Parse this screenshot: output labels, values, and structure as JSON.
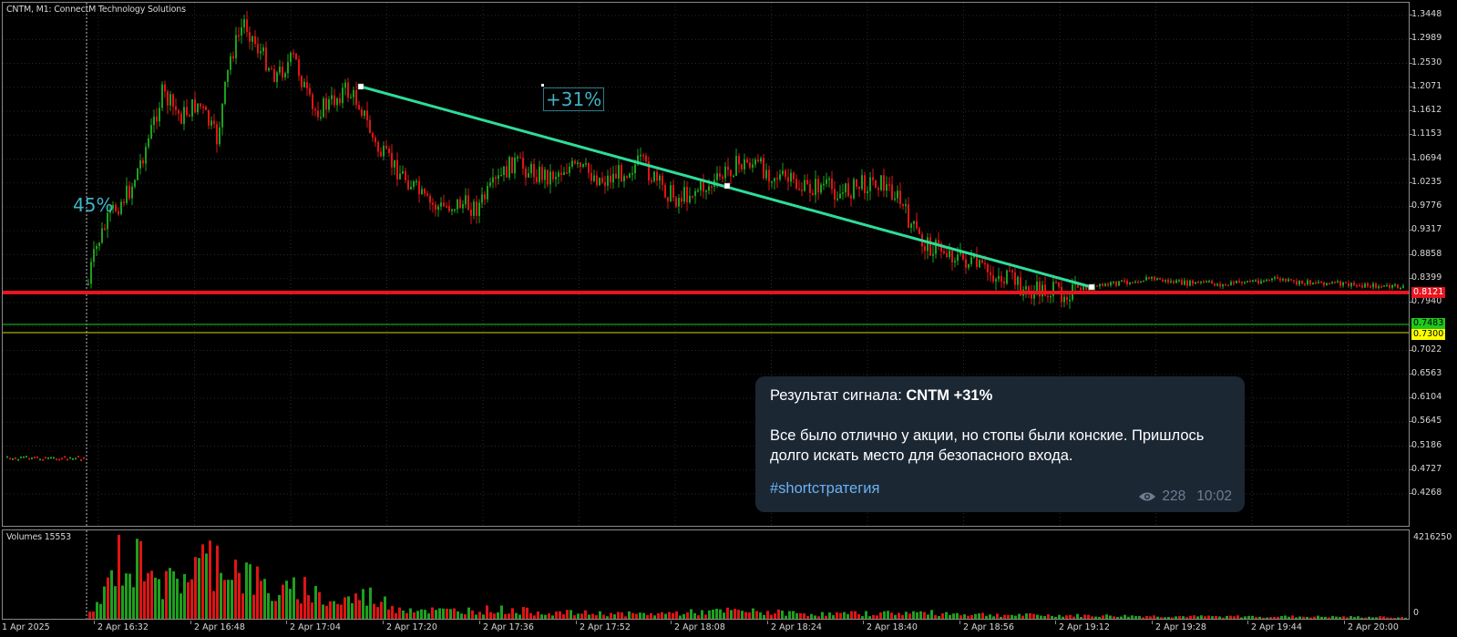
{
  "chart": {
    "symbol_label": "CNTM, M1:  ConnectM Technology Solutions",
    "volumes_label": "Volumes 15553",
    "price_ticks": [
      "1.3448",
      "1.2989",
      "1.2530",
      "1.2071",
      "1.1612",
      "1.1153",
      "1.0694",
      "1.0235",
      "0.9776",
      "0.9317",
      "0.8858",
      "0.8399",
      "0.7940",
      "0.7022",
      "0.6563",
      "0.6104",
      "0.5645",
      "0.5186",
      "0.4727",
      "0.4268"
    ],
    "price_badges": [
      {
        "text": "0.8121",
        "bg": "#e8141e",
        "fg": "#ffffff"
      },
      {
        "text": "0.7483",
        "bg": "#1ec81e",
        "fg": "#000000"
      },
      {
        "text": "0.7300",
        "bg": "#ffff00",
        "fg": "#000000"
      }
    ],
    "volume_axis_max": "4216250",
    "volume_axis_zero": "0",
    "time_ticks": [
      "1 Apr 2025",
      "2 Apr 16:32",
      "2 Apr 16:48",
      "2 Apr 17:04",
      "2 Apr 17:20",
      "2 Apr 17:36",
      "2 Apr 17:52",
      "2 Apr 18:08",
      "2 Apr 18:24",
      "2 Apr 18:40",
      "2 Apr 18:56",
      "2 Apr 19:12",
      "2 Apr 19:28",
      "2 Apr 19:44",
      "2 Apr 20:00"
    ],
    "annotation_entry_move": "45%",
    "annotation_signal_move": "+31%",
    "colors": {
      "bull": "#1ea01e",
      "bear": "#e01414",
      "trendline": "#2fdc9a",
      "level_red": "#e8141e",
      "level_green": "#1ec81e",
      "level_yellow": "#d8d800",
      "annotation": "#3fb3c9"
    }
  },
  "telegram_message": {
    "title_prefix": "Результат сигнала: ",
    "title_bold": "CNTM +31%",
    "body_line_1": "Все было отлично у акции, но стопы были конские. Пришлось",
    "body_line_2": "долго искать место для безопасного входа.",
    "hashtag": "#shortстратегия",
    "views": "228",
    "time": "10:02"
  }
}
